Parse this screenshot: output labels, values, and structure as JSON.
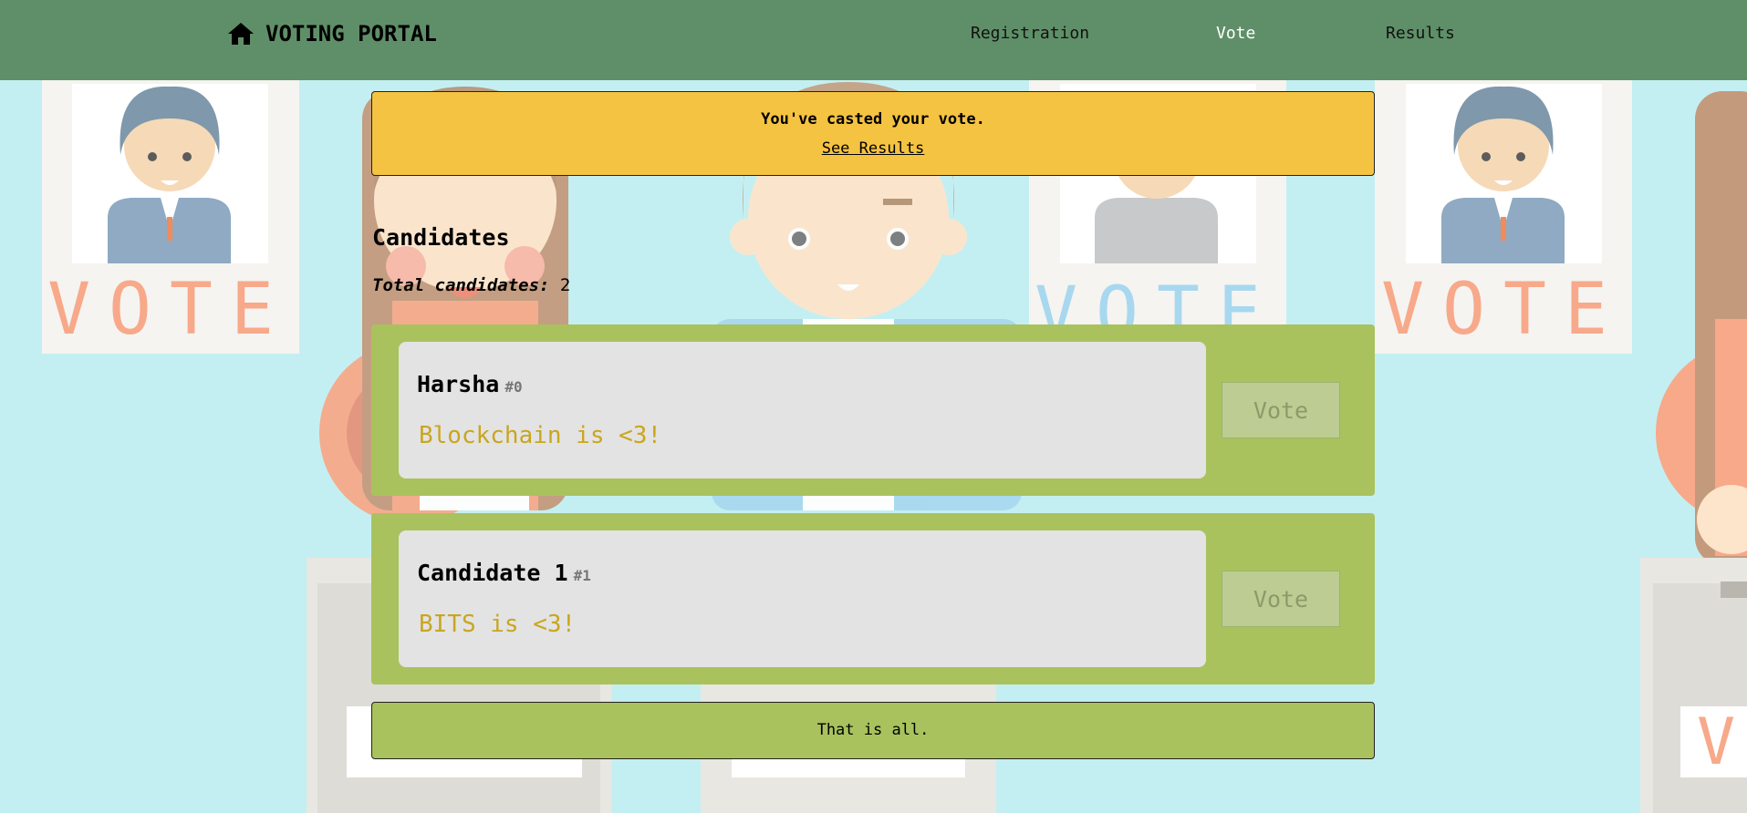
{
  "nav": {
    "brand_icon": "home-icon",
    "brand": "VOTING PORTAL",
    "links": [
      {
        "label": "Registration",
        "active": false
      },
      {
        "label": "Vote",
        "active": true
      },
      {
        "label": "Results",
        "active": false
      }
    ]
  },
  "notice": {
    "message": "You've casted your vote.",
    "link": "See Results"
  },
  "candidates": {
    "heading": "Candidates",
    "total_label": "Total candidates:",
    "total": "2",
    "items": [
      {
        "name": "Harsha",
        "id": "#0",
        "description": "Blockchain is <3!",
        "button": "Vote"
      },
      {
        "name": "Candidate 1",
        "id": "#1",
        "description": "BITS is <3!",
        "button": "Vote"
      }
    ]
  },
  "footer": {
    "text": "That is all."
  },
  "background": {
    "poster_text": "VOTE"
  },
  "colors": {
    "navbar": "#5f8f68",
    "page_bg": "#c4eff2",
    "notice_bg": "#f5c342",
    "candidate_row": "#a9c25d",
    "candidate_card": "#e3e3e3",
    "description_text": "#c9a620",
    "vote_button_disabled": "#bdcc92"
  }
}
